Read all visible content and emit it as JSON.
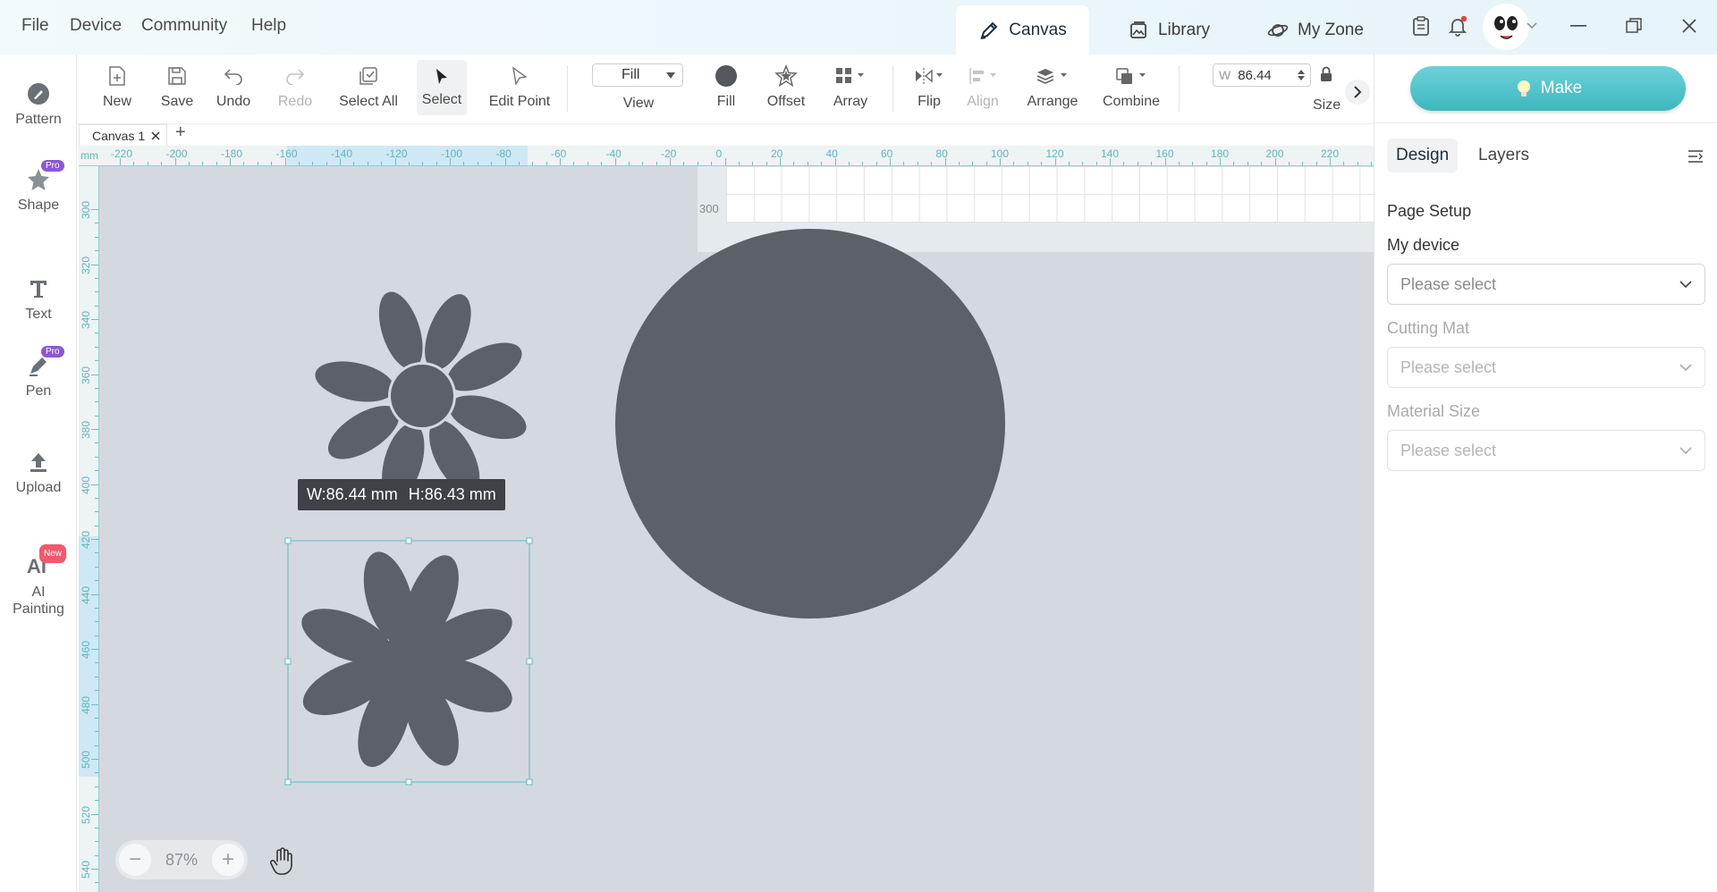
{
  "menu": [
    "File",
    "Device",
    "Community",
    "Help"
  ],
  "top_tabs": [
    {
      "label": "Canvas",
      "icon": "pen-canvas-icon"
    },
    {
      "label": "Library",
      "icon": "library-icon"
    },
    {
      "label": "My Zone",
      "icon": "planet-icon"
    }
  ],
  "left_tools": [
    {
      "label": "Pattern",
      "icon": "pattern-icon"
    },
    {
      "label": "Shape",
      "icon": "star-shape-icon",
      "badge": "Pro"
    },
    {
      "label": "Text",
      "icon": "text-icon"
    },
    {
      "label": "Pen",
      "icon": "pen-icon",
      "badge": "Pro"
    },
    {
      "label": "Upload",
      "icon": "upload-icon"
    },
    {
      "label": "AI",
      "label2": "Painting",
      "icon": "ai-icon",
      "badge": "New"
    }
  ],
  "toolbar": {
    "new": "New",
    "save": "Save",
    "undo": "Undo",
    "redo": "Redo",
    "select_all": "Select All",
    "select": "Select",
    "edit_point": "Edit Point",
    "view_value": "Fill",
    "view": "View",
    "fill": "Fill",
    "offset": "Offset",
    "array": "Array",
    "flip": "Flip",
    "align": "Align",
    "arrange": "Arrange",
    "combine": "Combine",
    "size_prefix": "W",
    "size_value": "86.44",
    "size": "Size"
  },
  "canvas_tab": {
    "label": "Canvas 1",
    "add": "+"
  },
  "ruler": {
    "unit": "mm",
    "h_labels": [
      "-220",
      "-200",
      "-180",
      "-160",
      "-140",
      "-120",
      "-100",
      "-80",
      "-60",
      "-40",
      "-20",
      "0",
      "20",
      "40",
      "60",
      "80",
      "100",
      "120",
      "140",
      "160",
      "180",
      "200",
      "220"
    ],
    "v_labels": [
      "300",
      "320",
      "340",
      "360",
      "380",
      "400",
      "420",
      "440",
      "460",
      "480",
      "500",
      "520",
      "540"
    ]
  },
  "mat_label": "300",
  "dimension_tooltip": {
    "w": "W:86.44 mm",
    "h": "H:86.43 mm"
  },
  "zoom": {
    "minus": "−",
    "value": "87%",
    "plus": "+"
  },
  "right_panel": {
    "make": "Make",
    "tabs": [
      "Design",
      "Layers"
    ],
    "page_setup": "Page Setup",
    "my_device": "My device",
    "cutting_mat": "Cutting Mat",
    "material_size": "Material Size",
    "placeholder": "Please select"
  },
  "colors": {
    "accent": "#4bbcc4",
    "shape": "#5c6067",
    "canvas_bg": "#d4d9df"
  }
}
